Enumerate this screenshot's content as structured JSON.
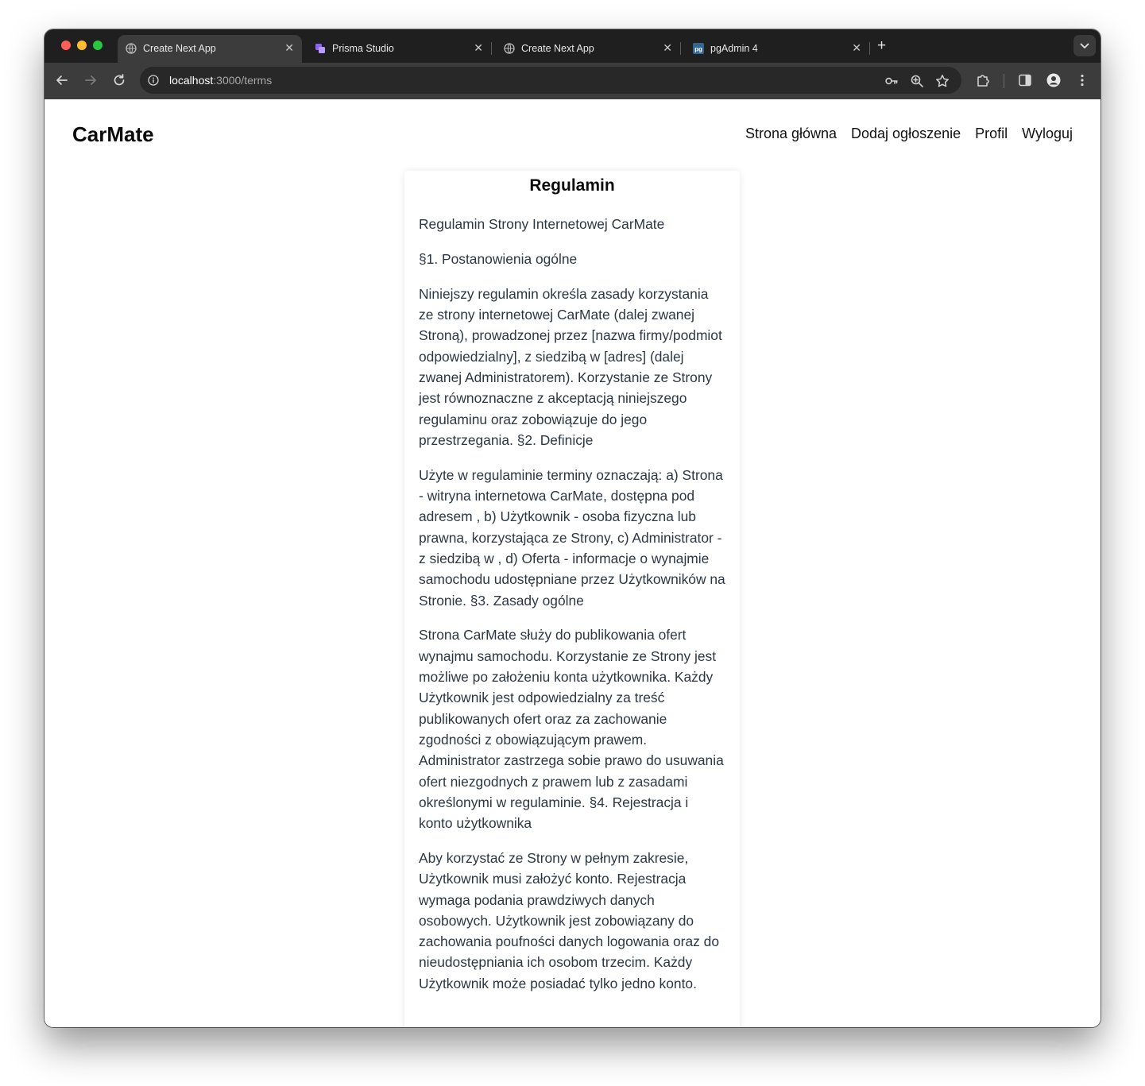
{
  "browser": {
    "tabs": [
      {
        "title": "Create Next App",
        "active": true,
        "favicon": "globe-icon"
      },
      {
        "title": "Prisma Studio",
        "active": false,
        "favicon": "prisma-icon"
      },
      {
        "title": "Create Next App",
        "active": false,
        "favicon": "globe-icon"
      },
      {
        "title": "pgAdmin 4",
        "active": false,
        "favicon": "pgadmin-icon"
      }
    ],
    "new_tab_label": "+",
    "close_label": "✕",
    "url_host": "localhost",
    "url_path": ":3000/terms"
  },
  "site": {
    "logo": "CarMate",
    "nav": [
      "Strona główna",
      "Dodaj ogłoszenie",
      "Profil",
      "Wyloguj"
    ]
  },
  "terms": {
    "heading": "Regulamin",
    "paragraphs": [
      "Regulamin Strony Internetowej CarMate",
      "§1. Postanowienia ogólne",
      "Niniejszy regulamin określa zasady korzystania ze strony internetowej CarMate (dalej zwanej Stroną), prowadzonej przez [nazwa firmy/podmiot odpowiedzialny], z siedzibą w [adres] (dalej zwanej Administratorem). Korzystanie ze Strony jest równoznaczne z akceptacją niniejszego regulaminu oraz zobowiązuje do jego przestrzegania. §2. Definicje",
      "Użyte w regulaminie terminy oznaczają: a) Strona - witryna internetowa CarMate, dostępna pod adresem , b) Użytkownik - osoba fizyczna lub prawna, korzystająca ze Strony, c) Administrator - z siedzibą w , d) Oferta - informacje o wynajmie samochodu udostępniane przez Użytkowników na Stronie. §3. Zasady ogólne",
      "Strona CarMate służy do publikowania ofert wynajmu samochodu. Korzystanie ze Strony jest możliwe po założeniu konta użytkownika. Każdy Użytkownik jest odpowiedzialny za treść publikowanych ofert oraz za zachowanie zgodności z obowiązującym prawem. Administrator zastrzega sobie prawo do usuwania ofert niezgodnych z prawem lub z zasadami określonymi w regulaminie. §4. Rejestracja i konto użytkownika",
      "Aby korzystać ze Strony w pełnym zakresie, Użytkownik musi założyć konto. Rejestracja wymaga podania prawdziwych danych osobowych. Użytkownik jest zobowiązany do zachowania poufności danych logowania oraz do nieudostępniania ich osobom trzecim. Każdy Użytkownik może posiadać tylko jedno konto."
    ]
  },
  "colors": {
    "tab_strip": "#1f1f1f",
    "toolbar": "#3c3c3c",
    "omnibox": "#282828",
    "body_text": "#2d3744"
  }
}
